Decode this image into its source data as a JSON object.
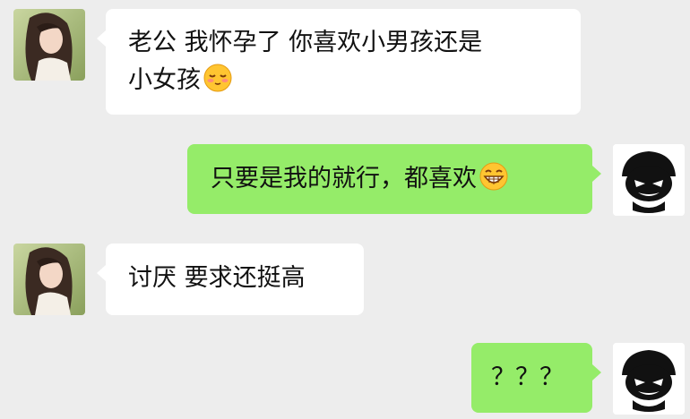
{
  "messages": [
    {
      "side": "in",
      "avatar_icon": "girl-photo-avatar-icon",
      "lines": [
        "老公 我怀孕了 你喜欢小男孩还是",
        "小女孩"
      ],
      "emoji": "shy-face-emoji"
    },
    {
      "side": "out",
      "avatar_icon": "cartoon-face-avatar-icon",
      "lines": [
        "只要是我的就行，都喜欢"
      ],
      "emoji": "grin-face-emoji"
    },
    {
      "side": "in",
      "avatar_icon": "girl-photo-avatar-icon",
      "lines": [
        "讨厌 要求还挺高"
      ]
    },
    {
      "side": "out",
      "avatar_icon": "cartoon-face-avatar-icon",
      "lines": [
        "？？？"
      ]
    }
  ],
  "colors": {
    "background": "#ededed",
    "incoming_bubble": "#ffffff",
    "outgoing_bubble": "#95ec69",
    "text": "#111111"
  }
}
